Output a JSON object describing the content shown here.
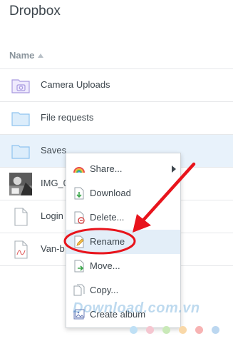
{
  "app_title": "Dropbox",
  "table": {
    "header_name": "Name"
  },
  "files": [
    {
      "name": "Camera Uploads",
      "icon": "camera-folder-icon"
    },
    {
      "name": "File requests",
      "icon": "folder-icon"
    },
    {
      "name": "Saves",
      "icon": "folder-icon",
      "selected": true
    },
    {
      "name": "IMG_0",
      "icon": "image-thumbnail-icon"
    },
    {
      "name": "Login",
      "icon": "document-icon"
    },
    {
      "name": "Van-b",
      "icon": "pdf-document-icon"
    }
  ],
  "context_menu": {
    "items": [
      {
        "label": "Share...",
        "icon": "share-rainbow-icon",
        "submenu": true
      },
      {
        "label": "Download",
        "icon": "download-icon"
      },
      {
        "label": "Delete...",
        "icon": "delete-icon"
      },
      {
        "label": "Rename",
        "icon": "rename-pencil-icon",
        "highlighted": true
      },
      {
        "label": "Move...",
        "icon": "move-icon"
      },
      {
        "label": "Copy...",
        "icon": "copy-icon"
      },
      {
        "label": "Create album",
        "icon": "album-icon"
      }
    ]
  },
  "watermark": {
    "text": "Download.com.vn"
  },
  "colors": {
    "selected_row": "#e8f2fb",
    "highlight_item": "#e3eef8",
    "annotation_red": "#e8141c",
    "folder_blue": "#8fc4ef",
    "camera_folder_purple": "#a99be0",
    "watermark_dots": [
      "#bfe0f5",
      "#f5c6d0",
      "#c9e9b8",
      "#f9d8a8",
      "#f7b3b3",
      "#bcd7f0"
    ]
  }
}
